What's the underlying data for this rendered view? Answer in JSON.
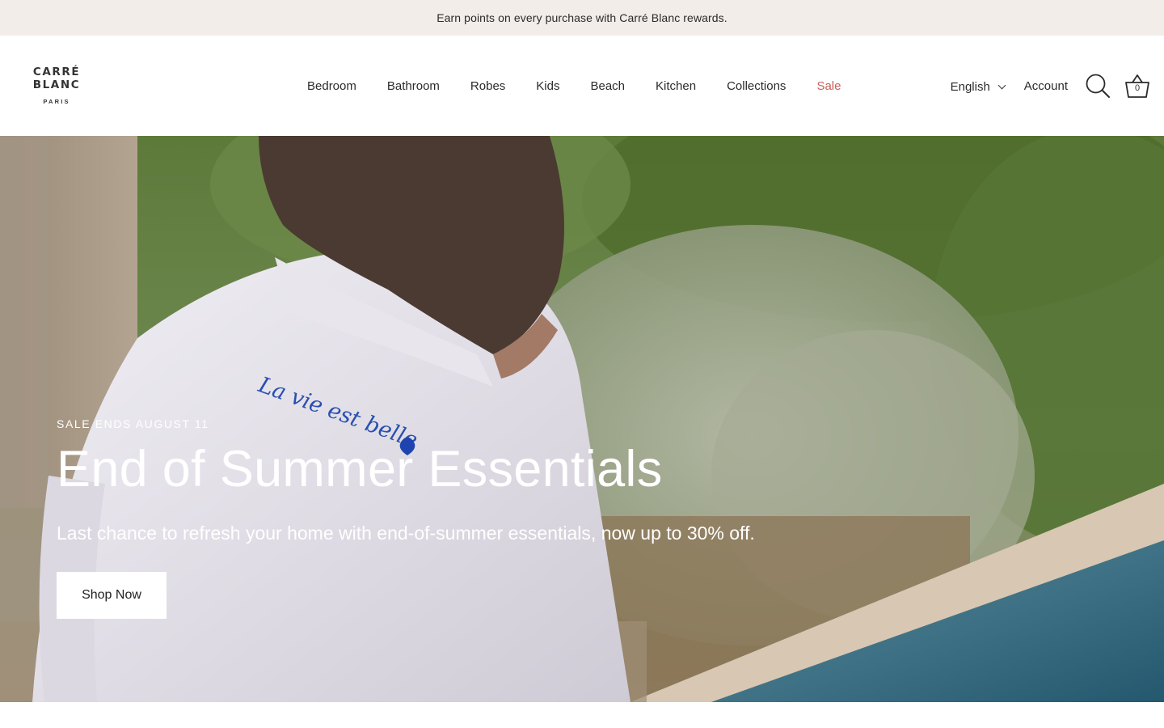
{
  "announcement": {
    "text": "Earn points on every purchase with Carré Blanc rewards."
  },
  "logo": {
    "line1": "CARRÉ",
    "line2": "BLANC",
    "line3": "PARIS"
  },
  "nav": {
    "items": [
      {
        "label": "Bedroom"
      },
      {
        "label": "Bathroom"
      },
      {
        "label": "Robes"
      },
      {
        "label": "Kids"
      },
      {
        "label": "Beach"
      },
      {
        "label": "Kitchen"
      },
      {
        "label": "Collections"
      },
      {
        "label": "Sale"
      }
    ]
  },
  "header": {
    "language": "English",
    "account": "Account",
    "cart_count": "0",
    "search_icon": "search-icon",
    "cart_icon": "basket-icon"
  },
  "hero": {
    "eyebrow": "SALE ENDS AUGUST 11",
    "title": "End of Summer Essentials",
    "subtitle": "Last chance to refresh your home with end-of-summer essentials, now up to 30% off.",
    "cta": "Shop Now",
    "robe_embroidery": "La vie est belle"
  },
  "colors": {
    "announcement_bg": "#f2ede9",
    "sale_link": "#c9605a",
    "hero_text": "#ffffff"
  }
}
